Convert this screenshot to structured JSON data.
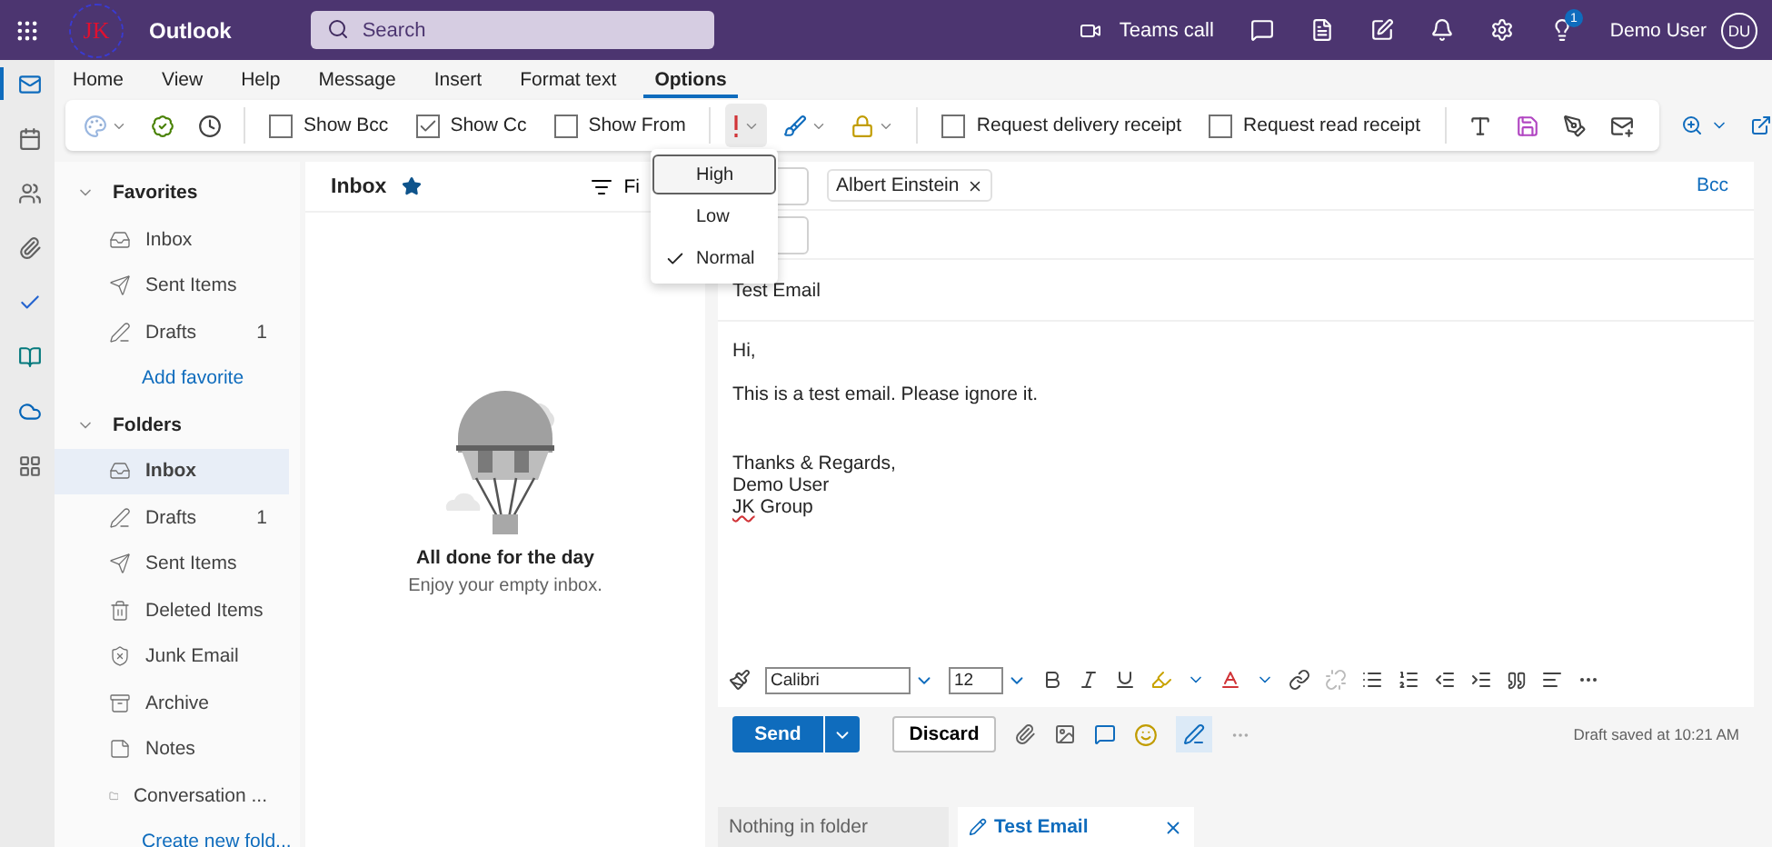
{
  "top_bar": {
    "logo_text": "JK",
    "app_name": "Outlook",
    "search": {
      "placeholder": "Search"
    },
    "teams_call": "Teams call",
    "tips_badge": "1",
    "user_name": "Demo User",
    "avatar": "DU"
  },
  "app_rail": [
    {
      "kind": "mail",
      "selected": true
    },
    {
      "kind": "calendar",
      "selected": false
    },
    {
      "kind": "people",
      "selected": false
    },
    {
      "kind": "files",
      "selected": false
    },
    {
      "kind": "todo",
      "selected": false
    },
    {
      "kind": "bookings",
      "selected": false
    },
    {
      "kind": "onedrive",
      "selected": false
    },
    {
      "kind": "apps",
      "selected": false
    }
  ],
  "ribbon_tabs": [
    {
      "label": "Home",
      "selected": false
    },
    {
      "label": "View",
      "selected": false
    },
    {
      "label": "Help",
      "selected": false
    },
    {
      "label": "Message",
      "selected": false
    },
    {
      "label": "Insert",
      "selected": false
    },
    {
      "label": "Format text",
      "selected": false
    },
    {
      "label": "Options",
      "selected": true
    }
  ],
  "toolbar": [
    {
      "kind": "button"
    },
    {
      "kind": "button"
    },
    {
      "kind": "button"
    },
    {
      "kind": "divider"
    },
    {
      "kind": "checkbox",
      "label": "Show Bcc",
      "checked": false
    },
    {
      "kind": "checkbox",
      "label": "Show Cc",
      "checked": true
    },
    {
      "kind": "checkbox",
      "label": "Show From",
      "checked": false
    },
    {
      "kind": "divider"
    },
    {
      "kind": "button",
      "open": true
    },
    {
      "kind": "button",
      "open": false
    },
    {
      "kind": "button",
      "open": false
    },
    {
      "kind": "divider"
    },
    {
      "kind": "checkbox",
      "label": "Request delivery receipt",
      "checked": false
    },
    {
      "kind": "checkbox",
      "label": "Request read receipt",
      "checked": false
    },
    {
      "kind": "divider"
    },
    {
      "kind": "button"
    },
    {
      "kind": "button"
    },
    {
      "kind": "button"
    },
    {
      "kind": "button"
    }
  ],
  "folder_pane": [
    {
      "title": "Favorites",
      "expanded": true,
      "items": [
        {
          "label": "Inbox",
          "kind": "inbox",
          "selected": false
        },
        {
          "label": "Sent Items",
          "kind": "sent",
          "selected": false
        },
        {
          "label": "Drafts",
          "kind": "drafts",
          "count": "1",
          "selected": false
        }
      ],
      "link": "Add favorite"
    },
    {
      "title": "Folders",
      "expanded": true,
      "items": [
        {
          "label": "Inbox",
          "kind": "inbox",
          "selected": true
        },
        {
          "label": "Drafts",
          "kind": "drafts",
          "count": "1",
          "selected": false
        },
        {
          "label": "Sent Items",
          "kind": "sent",
          "selected": false
        },
        {
          "label": "Deleted Items",
          "kind": "deleted",
          "selected": false
        },
        {
          "label": "Junk Email",
          "kind": "junk",
          "selected": false
        },
        {
          "label": "Archive",
          "kind": "archive",
          "selected": false
        },
        {
          "label": "Notes",
          "kind": "notes",
          "selected": false
        },
        {
          "label": "Conversation ...",
          "kind": "folder",
          "selected": false
        }
      ],
      "link": "Create new fold..."
    }
  ],
  "message_list": {
    "title": "Inbox",
    "favorite": true,
    "filter": "Fi",
    "empty_title": "All done for the day",
    "empty_subtitle": "Enjoy your empty inbox."
  },
  "importance_menu": [
    {
      "label": "High",
      "checked": false,
      "highlighted": true
    },
    {
      "label": "Low",
      "checked": false,
      "highlighted": false
    },
    {
      "label": "Normal",
      "checked": true,
      "highlighted": false
    }
  ],
  "compose": {
    "recipients": [
      "Albert Einstein"
    ],
    "bcc": "Bcc",
    "subject": "Test Email",
    "body": [
      {
        "lines": [
          {
            "text": "Hi,"
          }
        ]
      },
      {
        "lines": [
          {
            "text": "This is a test email. Please ignore it."
          }
        ]
      },
      {
        "lines": [
          {
            "text": "Thanks & Regards,"
          },
          {
            "text": "Demo User"
          },
          {
            "misspelled": "JK",
            "text": "Group"
          }
        ]
      }
    ],
    "font": "Calibri",
    "font_size": "12",
    "send": "Send",
    "discard": "Discard",
    "draft_status": "Draft saved at 10:21 AM"
  },
  "bottom_tabs": [
    {
      "label": "Nothing in folder",
      "selected": false,
      "editing": false
    },
    {
      "label": "Test Email",
      "selected": true,
      "editing": true
    }
  ]
}
